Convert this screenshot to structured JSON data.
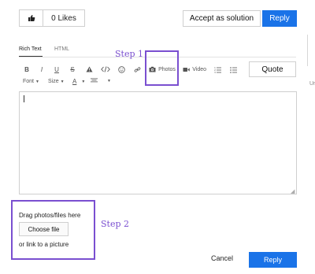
{
  "header": {
    "likes_label": "0 Likes",
    "accept_label": "Accept as solution",
    "reply_label": "Reply",
    "side_text": "Ur"
  },
  "tabs": [
    {
      "label": "Rich Text",
      "active": true
    },
    {
      "label": "HTML",
      "active": false
    }
  ],
  "annotations": {
    "step1": "Step 1",
    "step2": "Step 2"
  },
  "toolbar": {
    "icons": [
      "bold-icon",
      "italic-icon",
      "underline-icon",
      "strikethrough-icon",
      "warning-icon",
      "code-icon",
      "emoji-icon",
      "link-icon",
      "camera-icon",
      "video-icon",
      "numbered-list-icon",
      "bullet-list-icon"
    ],
    "photos_label": "Photos",
    "video_label": "Video",
    "quote_label": "Quote",
    "font_label": "Font",
    "size_label": "Size",
    "color_glyph": "A",
    "bold_glyph": "B",
    "italic_glyph": "I",
    "underline_glyph": "U",
    "strike_glyph": "S"
  },
  "editor": {
    "value": ""
  },
  "upload": {
    "drag_text": "Drag photos/files here",
    "choose_label": "Choose file",
    "link_text": "or link to a picture"
  },
  "footer": {
    "cancel_label": "Cancel",
    "reply_label": "Reply"
  },
  "colors": {
    "accent": "#1a73e8",
    "annotation": "#7a4fd0"
  }
}
